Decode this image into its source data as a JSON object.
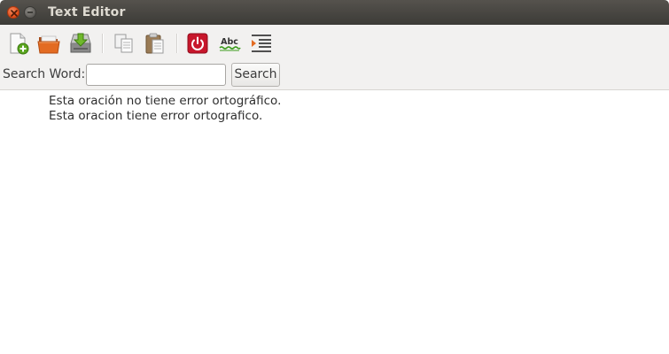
{
  "window": {
    "title": "Text Editor",
    "controls": [
      "close-icon",
      "minimize-icon"
    ]
  },
  "toolbar": {
    "buttons": [
      {
        "name": "new-file",
        "icon": "new-document-icon"
      },
      {
        "name": "open-file",
        "icon": "folder-open-icon"
      },
      {
        "name": "save-file",
        "icon": "save-download-icon"
      },
      {
        "name": "copy",
        "icon": "copy-icon"
      },
      {
        "name": "paste",
        "icon": "paste-icon"
      },
      {
        "name": "quit",
        "icon": "power-icon"
      },
      {
        "name": "spell-check",
        "icon": "spellcheck-abc-icon",
        "icon_text": "Abc"
      },
      {
        "name": "indent",
        "icon": "indent-icon"
      }
    ]
  },
  "search": {
    "label": "Search Word:",
    "value": "",
    "placeholder": "",
    "button_label": "Search"
  },
  "editor": {
    "lines": [
      "Esta oración no tiene error ortográfico.",
      "Esta oracion tiene error ortografico."
    ]
  },
  "colors": {
    "titlebar": "#3c3b37",
    "close_button": "#df4a16",
    "power_button": "#c7162b"
  }
}
